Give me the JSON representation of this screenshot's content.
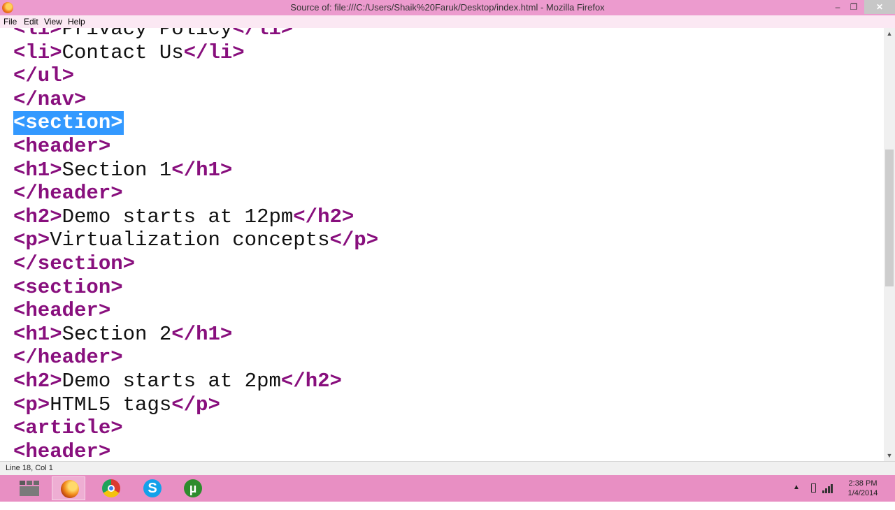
{
  "window": {
    "title": "Source of: file:///C:/Users/Shaik%20Faruk/Desktop/index.html - Mozilla Firefox",
    "minimize_glyph": "–",
    "maximize_glyph": "❐",
    "close_glyph": "✕"
  },
  "menu": {
    "items": [
      "File",
      "Edit",
      "View",
      "Help"
    ]
  },
  "source_lines": [
    {
      "parts": [
        [
          "t",
          "<li>"
        ],
        [
          "x",
          "Privacy Policy"
        ],
        [
          "t",
          "</li>"
        ]
      ]
    },
    {
      "parts": [
        [
          "t",
          "<li>"
        ],
        [
          "x",
          "Contact Us"
        ],
        [
          "t",
          "</li>"
        ]
      ]
    },
    {
      "parts": [
        [
          "t",
          "</ul>"
        ]
      ]
    },
    {
      "parts": [
        [
          "t",
          "</nav>"
        ]
      ]
    },
    {
      "parts": [
        [
          "t",
          "<section>"
        ]
      ],
      "selected": true
    },
    {
      "parts": [
        [
          "t",
          "<header>"
        ]
      ]
    },
    {
      "parts": [
        [
          "t",
          "<h1>"
        ],
        [
          "x",
          "Section 1"
        ],
        [
          "t",
          "</h1>"
        ]
      ]
    },
    {
      "parts": [
        [
          "t",
          "</header>"
        ]
      ]
    },
    {
      "parts": [
        [
          "t",
          "<h2>"
        ],
        [
          "x",
          "Demo starts at 12pm"
        ],
        [
          "t",
          "</h2>"
        ]
      ]
    },
    {
      "parts": [
        [
          "t",
          "<p>"
        ],
        [
          "x",
          "Virtualization concepts"
        ],
        [
          "t",
          "</p>"
        ]
      ]
    },
    {
      "parts": [
        [
          "t",
          "</section>"
        ]
      ]
    },
    {
      "parts": [
        [
          "t",
          "<section>"
        ]
      ]
    },
    {
      "parts": [
        [
          "t",
          "<header>"
        ]
      ]
    },
    {
      "parts": [
        [
          "t",
          "<h1>"
        ],
        [
          "x",
          "Section 2"
        ],
        [
          "t",
          "</h1>"
        ]
      ]
    },
    {
      "parts": [
        [
          "t",
          "</header>"
        ]
      ]
    },
    {
      "parts": [
        [
          "t",
          "<h2>"
        ],
        [
          "x",
          "Demo starts at 2pm"
        ],
        [
          "t",
          "</h2>"
        ]
      ]
    },
    {
      "parts": [
        [
          "t",
          "<p>"
        ],
        [
          "x",
          "HTML5 tags"
        ],
        [
          "t",
          "</p>"
        ]
      ]
    },
    {
      "parts": [
        [
          "t",
          "<article>"
        ]
      ]
    },
    {
      "parts": [
        [
          "t",
          "<header>"
        ]
      ]
    }
  ],
  "status": {
    "text": "Line 18, Col 1"
  },
  "taskbar": {
    "apps": [
      "file-explorer-icon",
      "firefox-icon",
      "chrome-icon",
      "skype-icon",
      "utorrent-icon"
    ],
    "active_app": "firefox-icon",
    "skype_glyph": "S",
    "utorrent_glyph": "µ",
    "tray_chevron": "▲",
    "clock_time": "2:38 PM",
    "clock_date": "1/4/2014"
  },
  "colors": {
    "titlebar": "#ec9bce",
    "taskbar": "#e88fc3",
    "tag": "#880f7d",
    "selection": "#3399ff"
  }
}
